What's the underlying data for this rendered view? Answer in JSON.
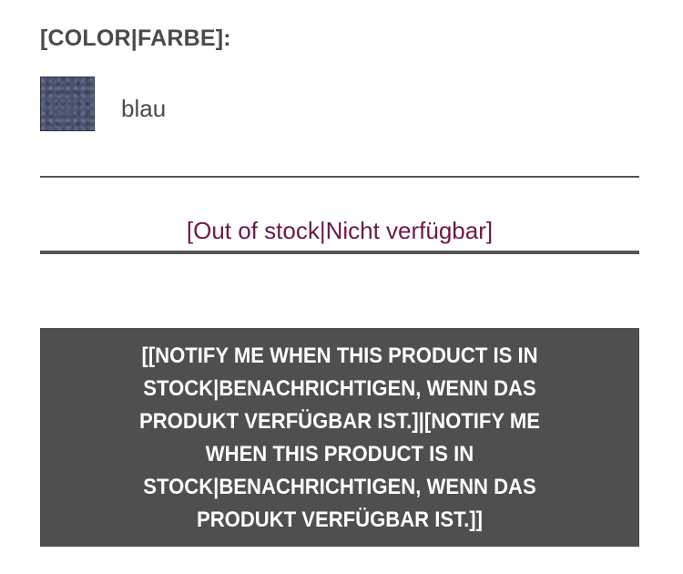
{
  "color_section": {
    "label": "[COLOR|FARBE]:",
    "swatch_color": "#4a5170",
    "selected_name": "blau"
  },
  "stock": {
    "status": "[Out of stock|Nicht verfügbar]",
    "status_color": "#6e1846"
  },
  "notify_button": {
    "label": "[[NOTIFY ME WHEN THIS PRODUCT IS IN STOCK|BENACHRICHTIGEN, WENN DAS PRODUKT VERFÜGBAR IST.]|[NOTIFY ME WHEN THIS PRODUCT IS IN STOCK|BENACHRICHTIGEN, WENN DAS PRODUKT VERFÜGBAR IST.]]",
    "background_color": "#4f4f4f"
  }
}
